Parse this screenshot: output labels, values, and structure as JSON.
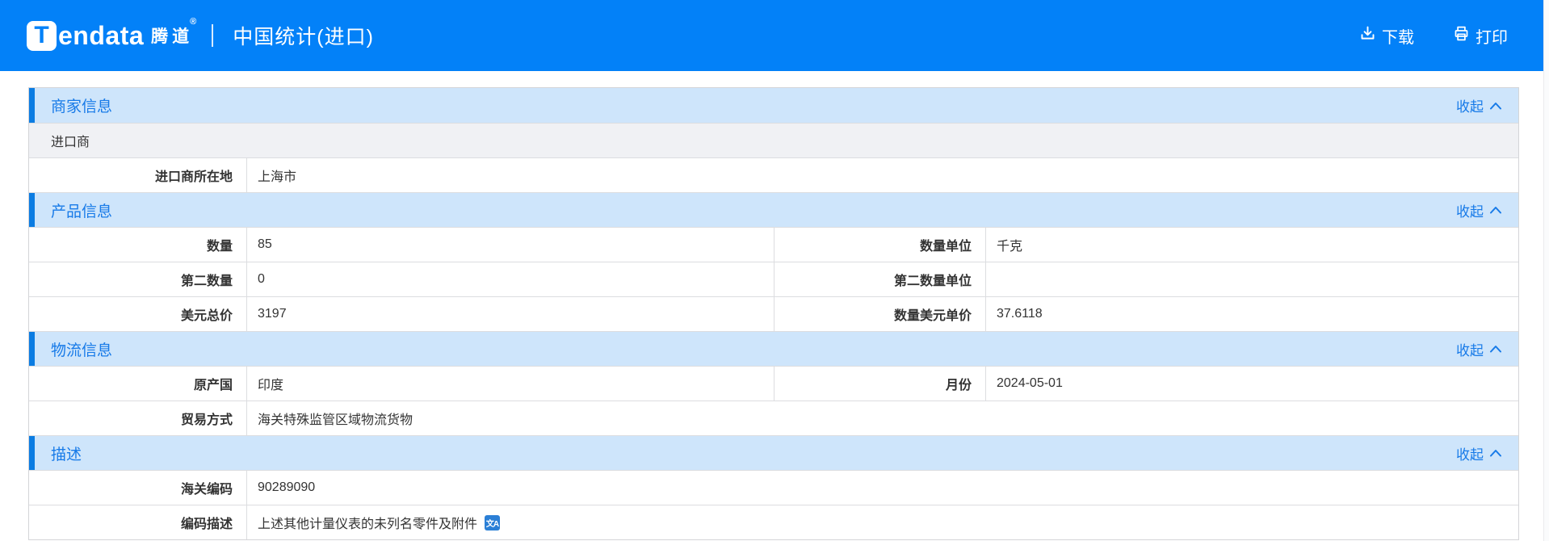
{
  "header": {
    "brand": {
      "logo_letter": "T",
      "name": "endata",
      "cn": "腾道",
      "reg": "®"
    },
    "title": "中国统计(进口)",
    "actions": [
      {
        "id": "download",
        "label": "下载",
        "icon": "download-icon"
      },
      {
        "id": "print",
        "label": "打印",
        "icon": "print-icon"
      }
    ]
  },
  "collapse_label": "收起",
  "icons": {
    "collapse": "chevron-up-icon",
    "translate_glyph": "文A"
  },
  "colors": {
    "topbar": "#0381f8",
    "section_header_bg": "#cee5fb",
    "section_accent": "#0b7ce2",
    "link_blue": "#177ae8",
    "row_alt_bg": "#f0f1f4",
    "translate_icon_bg": "#2b7fd6"
  },
  "sections": [
    {
      "title": "商家信息",
      "rows": [
        {
          "type": "text",
          "text": "进口商"
        },
        {
          "type": "kv",
          "label": "进口商所在地",
          "value": "上海市"
        }
      ]
    },
    {
      "title": "产品信息",
      "rows": [
        {
          "type": "kvkv",
          "label1": "数量",
          "value1": "85",
          "label2": "数量单位",
          "value2": "千克"
        },
        {
          "type": "kvkv",
          "label1": "第二数量",
          "value1": "0",
          "label2": "第二数量单位",
          "value2": ""
        },
        {
          "type": "kvkv",
          "label1": "美元总价",
          "value1": "3197",
          "label2": "数量美元单价",
          "value2": "37.6118"
        }
      ]
    },
    {
      "title": "物流信息",
      "rows": [
        {
          "type": "kvkv",
          "label1": "原产国",
          "value1": "印度",
          "label2": "月份",
          "value2": "2024-05-01"
        },
        {
          "type": "kv",
          "label": "贸易方式",
          "value": "海关特殊监管区域物流货物"
        }
      ]
    },
    {
      "title": "描述",
      "rows": [
        {
          "type": "kv",
          "label": "海关编码",
          "value": "90289090"
        },
        {
          "type": "kv",
          "label": "编码描述",
          "value": "上述其他计量仪表的未列名零件及附件",
          "icon": "translate-icon"
        }
      ]
    }
  ]
}
